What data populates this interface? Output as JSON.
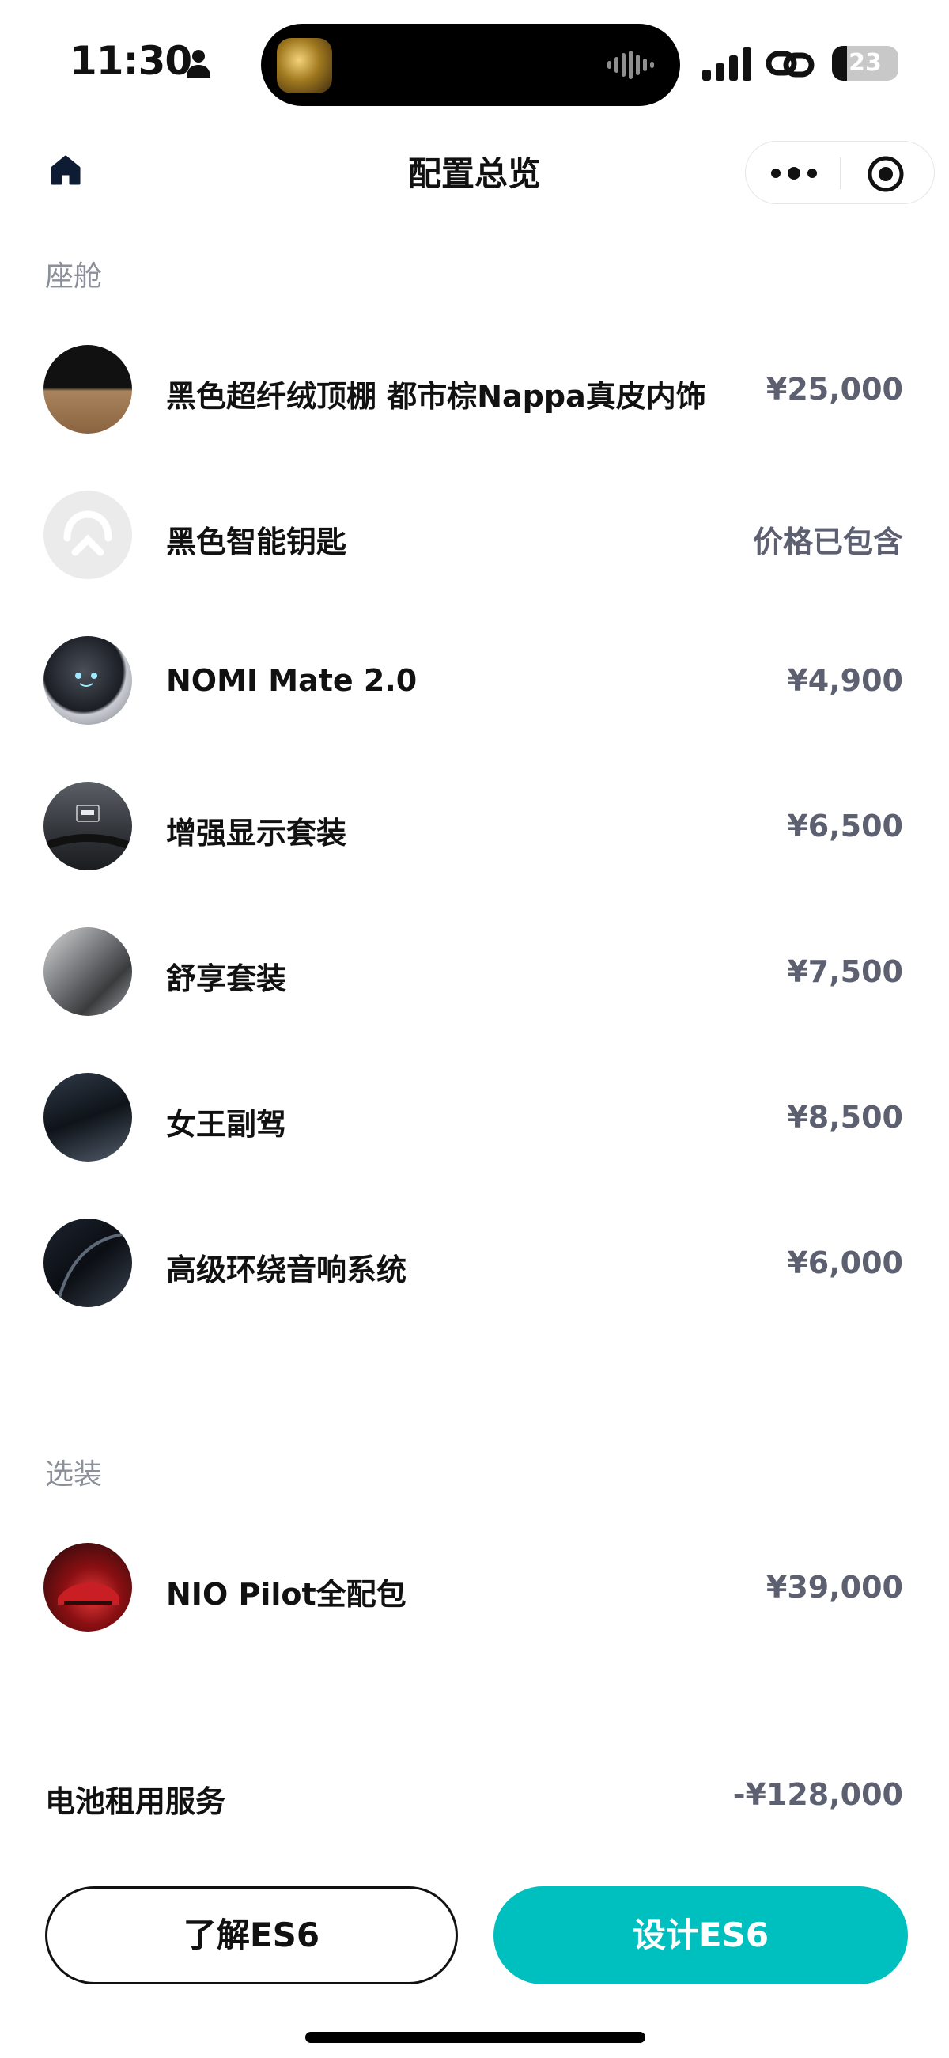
{
  "status_bar": {
    "time": "11:30",
    "battery_level": "23",
    "battery_fraction": 0.23,
    "icons": [
      "person-icon",
      "signal-icon",
      "link-icon",
      "battery-icon"
    ]
  },
  "nav": {
    "title": "配置总览",
    "icons": [
      "home-icon",
      "more-icon",
      "target-icon"
    ]
  },
  "cabin": {
    "label": "座舱",
    "items": [
      {
        "label": "黑色超纤绒顶棚 都市棕Nappa真皮内饰",
        "price": "¥25,000"
      },
      {
        "label": "黑色智能钥匙",
        "price": "价格已包含"
      },
      {
        "label": "NOMI Mate 2.0",
        "price": "¥4,900"
      },
      {
        "label": "增强显示套装",
        "price": "¥6,500"
      },
      {
        "label": "舒享套装",
        "price": "¥7,500"
      },
      {
        "label": "女王副驾",
        "price": "¥8,500"
      },
      {
        "label": "高级环绕音响系统",
        "price": "¥6,000"
      }
    ]
  },
  "options": {
    "label": "选装",
    "items": [
      {
        "label": "NIO Pilot全配包",
        "price": "¥39,000"
      }
    ]
  },
  "battery_service": {
    "label": "电池租用服务",
    "value": "-¥128,000"
  },
  "buttons": {
    "learn": "了解ES6",
    "design": "设计ES6"
  },
  "colors": {
    "accent": "#00bfbf",
    "price_text": "#5d6070",
    "section_label": "#8b8f99"
  }
}
